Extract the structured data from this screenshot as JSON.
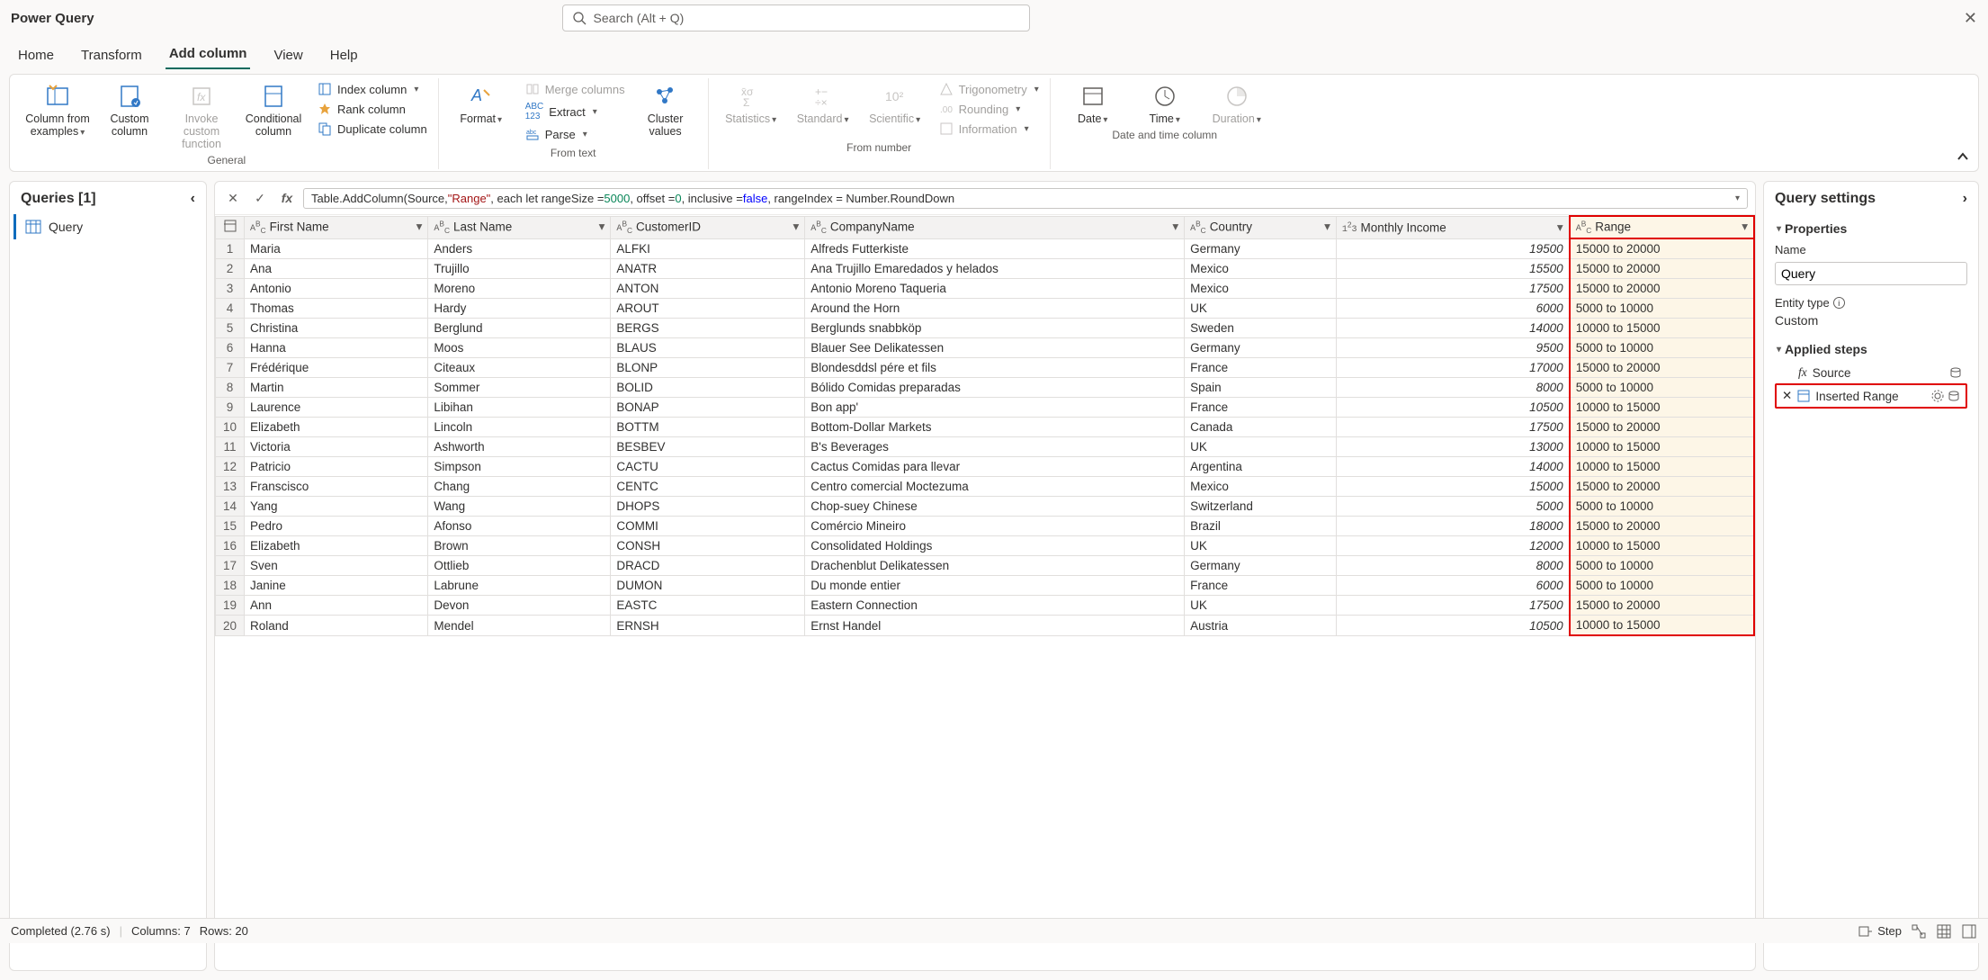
{
  "app_title": "Power Query",
  "search_placeholder": "Search (Alt + Q)",
  "tabs": [
    "Home",
    "Transform",
    "Add column",
    "View",
    "Help"
  ],
  "active_tab": "Add column",
  "ribbon": {
    "group_general": "General",
    "group_fromtext": "From text",
    "group_fromnumber": "From number",
    "group_datetime": "Date and time column",
    "col_from_examples": "Column from examples",
    "custom_column": "Custom column",
    "invoke_custom": "Invoke custom function",
    "conditional_column": "Conditional column",
    "index_column": "Index column",
    "rank_column": "Rank column",
    "duplicate_column": "Duplicate column",
    "format": "Format",
    "merge_columns": "Merge columns",
    "extract": "Extract",
    "parse": "Parse",
    "cluster_values": "Cluster values",
    "statistics": "Statistics",
    "standard": "Standard",
    "scientific": "Scientific",
    "trigonometry": "Trigonometry",
    "rounding": "Rounding",
    "information": "Information",
    "date": "Date",
    "time": "Time",
    "duration": "Duration"
  },
  "queries_header": "Queries [1]",
  "query_name": "Query",
  "formula_prefix": "Table.AddColumn(Source, ",
  "formula_range": "\"Range\"",
  "formula_each": ", each let rangeSize = ",
  "formula_5000": "5000",
  "formula_offset": ", offset = ",
  "formula_0": "0",
  "formula_incl": ", inclusive = ",
  "formula_false": "false",
  "formula_tail": ", rangeIndex = Number.RoundDown",
  "columns": [
    "First Name",
    "Last Name",
    "CustomerID",
    "CompanyName",
    "Country",
    "Monthly Income",
    "Range"
  ],
  "rows": [
    [
      "Maria",
      "Anders",
      "ALFKI",
      "Alfreds Futterkiste",
      "Germany",
      "19500",
      "15000 to 20000"
    ],
    [
      "Ana",
      "Trujillo",
      "ANATR",
      "Ana Trujillo Emaredados y helados",
      "Mexico",
      "15500",
      "15000 to 20000"
    ],
    [
      "Antonio",
      "Moreno",
      "ANTON",
      "Antonio Moreno Taqueria",
      "Mexico",
      "17500",
      "15000 to 20000"
    ],
    [
      "Thomas",
      "Hardy",
      "AROUT",
      "Around the Horn",
      "UK",
      "6000",
      "5000 to 10000"
    ],
    [
      "Christina",
      "Berglund",
      "BERGS",
      "Berglunds snabbköp",
      "Sweden",
      "14000",
      "10000 to 15000"
    ],
    [
      "Hanna",
      "Moos",
      "BLAUS",
      "Blauer See Delikatessen",
      "Germany",
      "9500",
      "5000 to 10000"
    ],
    [
      "Frédérique",
      "Citeaux",
      "BLONP",
      "Blondesddsl pére et fils",
      "France",
      "17000",
      "15000 to 20000"
    ],
    [
      "Martin",
      "Sommer",
      "BOLID",
      "Bólido Comidas preparadas",
      "Spain",
      "8000",
      "5000 to 10000"
    ],
    [
      "Laurence",
      "Libihan",
      "BONAP",
      "Bon app'",
      "France",
      "10500",
      "10000 to 15000"
    ],
    [
      "Elizabeth",
      "Lincoln",
      "BOTTM",
      "Bottom-Dollar Markets",
      "Canada",
      "17500",
      "15000 to 20000"
    ],
    [
      "Victoria",
      "Ashworth",
      "BESBEV",
      "B's Beverages",
      "UK",
      "13000",
      "10000 to 15000"
    ],
    [
      "Patricio",
      "Simpson",
      "CACTU",
      "Cactus Comidas para llevar",
      "Argentina",
      "14000",
      "10000 to 15000"
    ],
    [
      "Franscisco",
      "Chang",
      "CENTC",
      "Centro comercial Moctezuma",
      "Mexico",
      "15000",
      "15000 to 20000"
    ],
    [
      "Yang",
      "Wang",
      "DHOPS",
      "Chop-suey Chinese",
      "Switzerland",
      "5000",
      "5000 to 10000"
    ],
    [
      "Pedro",
      "Afonso",
      "COMMI",
      "Comércio Mineiro",
      "Brazil",
      "18000",
      "15000 to 20000"
    ],
    [
      "Elizabeth",
      "Brown",
      "CONSH",
      "Consolidated Holdings",
      "UK",
      "12000",
      "10000 to 15000"
    ],
    [
      "Sven",
      "Ottlieb",
      "DRACD",
      "Drachenblut Delikatessen",
      "Germany",
      "8000",
      "5000 to 10000"
    ],
    [
      "Janine",
      "Labrune",
      "DUMON",
      "Du monde entier",
      "France",
      "6000",
      "5000 to 10000"
    ],
    [
      "Ann",
      "Devon",
      "EASTC",
      "Eastern Connection",
      "UK",
      "17500",
      "15000 to 20000"
    ],
    [
      "Roland",
      "Mendel",
      "ERNSH",
      "Ernst Handel",
      "Austria",
      "10500",
      "10000 to 15000"
    ]
  ],
  "settings": {
    "title": "Query settings",
    "properties": "Properties",
    "name_label": "Name",
    "name_value": "Query",
    "entity_label": "Entity type",
    "entity_value": "Custom",
    "applied_steps": "Applied steps",
    "step_source": "Source",
    "step_inserted": "Inserted Range"
  },
  "status": {
    "completed": "Completed (2.76 s)",
    "columns": "Columns: 7",
    "rows": "Rows: 20",
    "step_btn": "Step"
  }
}
